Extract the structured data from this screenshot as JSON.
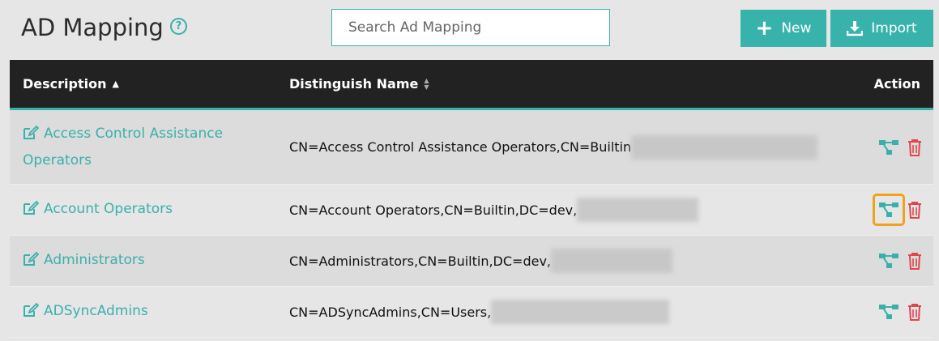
{
  "header": {
    "title": "AD Mapping",
    "help_icon": "question-circle-icon",
    "search_placeholder": "Search Ad Mapping",
    "new_label": "New",
    "import_label": "Import"
  },
  "colors": {
    "accent": "#37b3ac",
    "header_bg": "#222222",
    "delete": "#e0474c",
    "highlight": "#f0a21a"
  },
  "table": {
    "columns": {
      "description": "Description",
      "distinguish_name": "Distinguish Name",
      "action": "Action"
    },
    "sort": {
      "column": "description",
      "direction": "ascending"
    },
    "rows": [
      {
        "description": "Access Control Assistance Operators",
        "dn": "CN=Access Control Assistance Operators,CN=Builtin",
        "highlighted": false
      },
      {
        "description": "Account Operators",
        "dn": "CN=Account Operators,CN=Builtin,DC=dev,",
        "highlighted": true
      },
      {
        "description": "Administrators",
        "dn": "CN=Administrators,CN=Builtin,DC=dev,",
        "highlighted": false
      },
      {
        "description": "ADSyncAdmins",
        "dn": "CN=ADSyncAdmins,CN=Users,",
        "highlighted": false
      }
    ]
  }
}
